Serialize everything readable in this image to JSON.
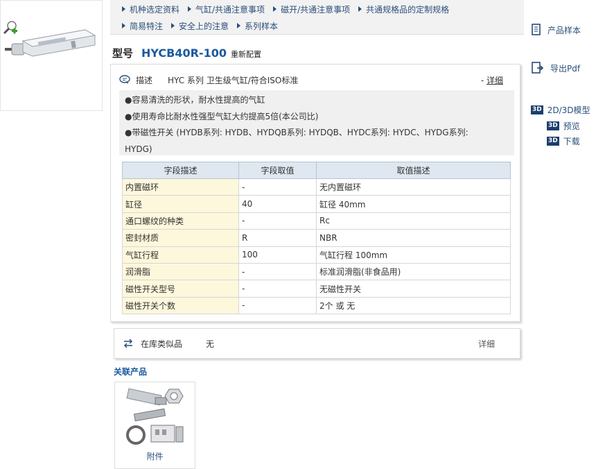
{
  "nav": {
    "row1": [
      "机种选定资料",
      "气缸/共通注意事项",
      "磁开/共通注意事项",
      "共通规格品的定制规格"
    ],
    "row2": [
      "简易特注",
      "安全上的注意",
      "系列样本"
    ]
  },
  "title": {
    "label": "型号",
    "code": "HYCB40R-100",
    "reset": "重新配置"
  },
  "side": {
    "catalog": "产品样本",
    "export_pdf": "导出Pdf",
    "model_2d3d": "2D/3D模型",
    "preview": "预览",
    "download": "下载",
    "badge": "3D"
  },
  "description": {
    "label": "描述",
    "text": "HYC 系列 卫生级气缸/符合ISO标准",
    "detail_prefix": "- ",
    "detail": "详细",
    "features": [
      "●容易清洗的形状，耐水性提高的气缸",
      "●使用寿命比耐水性强型气缸大约提高5倍(本公司比)",
      "●带磁性开关 (HYDB系列: HYDB、HYDQB系列: HYDQB、HYDC系列: HYDC、HYDG系列:",
      "HYDG)"
    ]
  },
  "table": {
    "headers": [
      "字段描述",
      "字段取值",
      "取值描述"
    ],
    "rows": [
      [
        "内置磁环",
        "-",
        "无内置磁环"
      ],
      [
        "缸径",
        "40",
        "缸径 40mm"
      ],
      [
        "通口螺纹的种类",
        "-",
        "Rc"
      ],
      [
        "密封材质",
        "R",
        "NBR"
      ],
      [
        "气缸行程",
        "100",
        "气缸行程 100mm"
      ],
      [
        "润滑脂",
        "-",
        "标准润滑脂(非食品用)"
      ],
      [
        "磁性开关型号",
        "-",
        "无磁性开关"
      ],
      [
        "磁性开关个数",
        "-",
        "2个 或 无"
      ]
    ]
  },
  "stock": {
    "label": "在库类似品",
    "value": "无",
    "detail": "详细"
  },
  "related": {
    "title": "关联产品",
    "item": "附件"
  },
  "icons": [
    "zoom-icon",
    "comment-icon",
    "catalog-icon",
    "pdf-export-icon",
    "swap-icon",
    "nav-arrow-icon"
  ]
}
